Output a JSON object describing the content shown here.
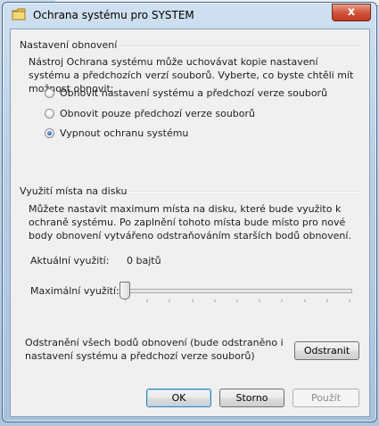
{
  "window": {
    "title": "Ochrana systému pro SYSTEM",
    "close_symbol": "x"
  },
  "restore_settings": {
    "group_label": "Nastavení obnovení",
    "description": "Nástroj Ochrana systému může uchovávat kopie nastavení systému a předchozích verzí souborů. Vyberte, co byste chtěli mít možnost obnovit:",
    "options": [
      {
        "label": "Obnovit nastavení systému a předchozí verze souborů",
        "selected": false
      },
      {
        "label": "Obnovit pouze předchozí verze souborů",
        "selected": false
      },
      {
        "label": "Vypnout ochranu systému",
        "selected": true
      }
    ]
  },
  "disk_usage": {
    "group_label": "Využití místa na disku",
    "description": "Můžete nastavit maximum místa na disku, které bude využito k ochraně systému. Po zaplnění tohoto místa bude místo pro nové body obnovení vytvářeno odstraňováním starších bodů obnovení.",
    "current_label": "Aktuální využití:",
    "current_value": "0 bajtů",
    "max_label": "Maximální využití:",
    "max_slider_fraction": 0
  },
  "delete_points": {
    "description": "Odstranění všech bodů obnovení (bude odstraněno i nastavení systému a předchozí verze souborů)",
    "button_label": "Odstranit"
  },
  "footer": {
    "ok_label": "OK",
    "cancel_label": "Storno",
    "apply_label": "Použít"
  },
  "colors": {
    "close_button": "#c2381d",
    "radio_selected": "#2a62a8",
    "default_button_border": "#3c7fb1"
  }
}
